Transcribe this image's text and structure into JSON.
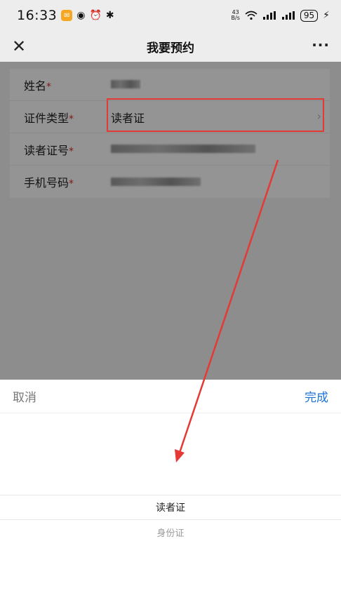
{
  "status_bar": {
    "time": "16:33",
    "speed_top": "43",
    "speed_bottom": "B/s",
    "battery": "95"
  },
  "nav": {
    "title": "我要预约",
    "close_glyph": "✕",
    "more_glyph": "···"
  },
  "form": {
    "fields": [
      {
        "label": "姓名",
        "required": "*",
        "value": ""
      },
      {
        "label": "证件类型",
        "required": "*",
        "value": "读者证"
      },
      {
        "label": "读者证号",
        "required": "*",
        "value": ""
      },
      {
        "label": "手机号码",
        "required": "*",
        "value": ""
      }
    ]
  },
  "picker": {
    "cancel": "取消",
    "done": "完成",
    "options": [
      "读者证",
      "身份证"
    ],
    "selected_index": 0
  },
  "colors": {
    "accent": "#1a73d6",
    "required": "#d9302c",
    "highlight": "#e53935"
  }
}
